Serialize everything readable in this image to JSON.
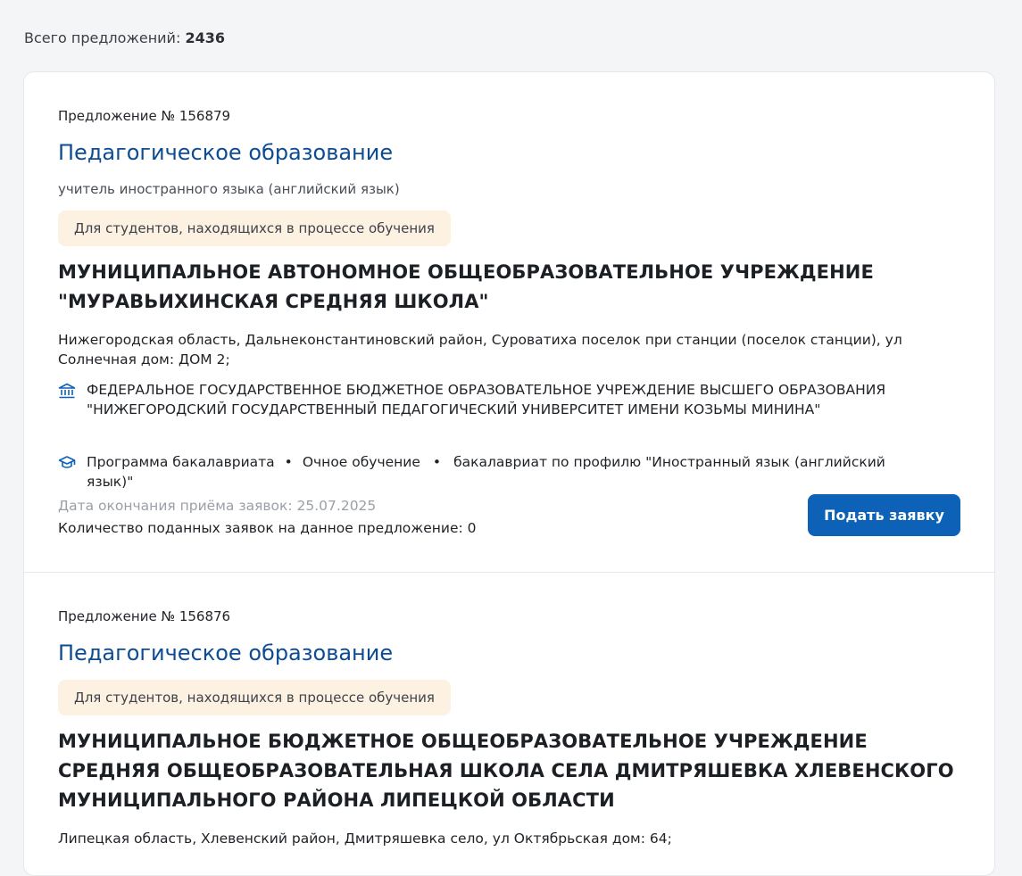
{
  "summary": {
    "label": "Всего предложений:",
    "count": "2436"
  },
  "offers": [
    {
      "number": "Предложение № 156879",
      "title": "Педагогическое образование",
      "subtitle": "учитель иностранного языка (английский язык)",
      "badge": "Для студентов, находящихся в процессе обучения",
      "organization": "МУНИЦИПАЛЬНОЕ АВТОНОМНОЕ ОБЩЕОБРАЗОВАТЕЛЬНОЕ УЧРЕЖДЕНИЕ \"МУРАВЬИХИНСКАЯ СРЕДНЯЯ ШКОЛА\"",
      "address": "Нижегородская область, Дальнеконстантиновский район, Суроватиха поселок при станции (поселок станции), ул Солнечная дом: ДОМ 2;",
      "university": "ФЕДЕРАЛЬНОЕ ГОСУДАРСТВЕННОЕ БЮДЖЕТНОЕ ОБРАЗОВАТЕЛЬНОЕ УЧРЕЖДЕНИЕ ВЫСШЕГО ОБРАЗОВАНИЯ \"НИЖЕГОРОДСКИЙ ГОСУДАРСТВЕННЫЙ ПЕДАГОГИЧЕСКИЙ УНИВЕРСИТЕТ ИМЕНИ КОЗЬМЫ МИНИНА\"",
      "program": {
        "level": "Программа бакалавриата",
        "form": "Очное обучение",
        "profile": "бакалавриат по профилю \"Иностранный язык (английский язык)\"",
        "separator": "•"
      },
      "deadline": "Дата окончания приёма заявок: 25.07.2025",
      "applications": "Количество поданных заявок на данное предложение: 0",
      "apply_label": "Подать заявку"
    },
    {
      "number": "Предложение № 156876",
      "title": "Педагогическое образование",
      "badge": "Для студентов, находящихся в процессе обучения",
      "organization": "МУНИЦИПАЛЬНОЕ БЮДЖЕТНОЕ ОБЩЕОБРАЗОВАТЕЛЬНОЕ УЧРЕЖДЕНИЕ СРЕДНЯЯ ОБЩЕОБРАЗОВАТЕЛЬНАЯ ШКОЛА СЕЛА ДМИТРЯШЕВКА ХЛЕВЕНСКОГО МУНИЦИПАЛЬНОГО РАЙОНА ЛИПЕЦКОЙ ОБЛАСТИ",
      "address": "Липецкая область, Хлевенский район, Дмитряшевка село, ул Октябрьская дом: 64;"
    }
  ],
  "icons": {
    "university": "university-building-icon",
    "program": "graduation-cap-icon"
  },
  "colors": {
    "accent": "#0d62b8",
    "title": "#0d4c94",
    "badge_bg": "#fdf1e2",
    "muted": "#9aa0a6"
  }
}
